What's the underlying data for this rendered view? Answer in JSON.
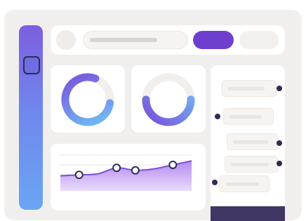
{
  "colors": {
    "background": "#f1efee",
    "sidebar_top": "#7d5fe0",
    "sidebar_bottom": "#6aa6f3",
    "accent": "#6e3fcf",
    "dark": "#2f2a55",
    "card": "#ffffff"
  },
  "icons": {
    "avatar": "avatar-icon",
    "sidebar_active": "dashboard-icon"
  },
  "donuts": [
    {
      "name": "donut-chart-1",
      "fraction": 0.78,
      "gradient": [
        "#6ec3f6",
        "#7b4fdb"
      ]
    },
    {
      "name": "donut-chart-2",
      "fraction": 0.5,
      "gradient": [
        "#6ec3f6",
        "#7b4fdb"
      ]
    }
  ],
  "chart_data": {
    "type": "area",
    "x": [
      0,
      1,
      2,
      3,
      4,
      5,
      6,
      7
    ],
    "series": [
      {
        "values": [
          3.0,
          3.2,
          3.4,
          4.6,
          4.1,
          4.4,
          5.2,
          6.0
        ]
      }
    ],
    "markers_at": [
      1,
      3,
      4,
      6
    ],
    "ylim": [
      0,
      8
    ],
    "grid": true
  },
  "list": {
    "rows": [
      {
        "dot_side": "right"
      },
      {
        "dot_side": "left"
      },
      {
        "dot_side": "right"
      },
      {
        "dot_side": "right"
      },
      {
        "dot_side": "left"
      }
    ]
  }
}
